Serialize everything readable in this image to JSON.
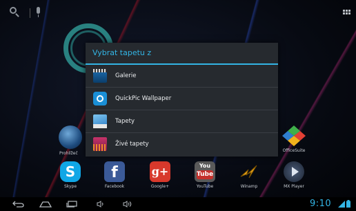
{
  "dialog": {
    "title": "Vybrat tapetu z",
    "items": [
      {
        "label": "Galerie",
        "icon": "gallery-icon"
      },
      {
        "label": "QuickPic Wallpaper",
        "icon": "quickpic-icon"
      },
      {
        "label": "Tapety",
        "icon": "wallpapers-icon"
      },
      {
        "label": "Živé tapety",
        "icon": "live-wallpapers-icon"
      }
    ]
  },
  "home": {
    "row_labels": [
      "Prohlížeč",
      "OfficeSuite"
    ],
    "dock": [
      {
        "label": "Skype",
        "icon": "skype-icon"
      },
      {
        "label": "Facebook",
        "icon": "facebook-icon"
      },
      {
        "label": "Google+",
        "icon": "googleplus-icon"
      },
      {
        "label": "YouTube",
        "icon": "youtube-icon"
      },
      {
        "label": "Winamp",
        "icon": "winamp-icon"
      },
      {
        "label": "MX Player",
        "icon": "mxplayer-icon"
      }
    ],
    "youtube_glyph": {
      "top": "You",
      "bottom": "Tube"
    },
    "facebook_glyph": "f",
    "googleplus_glyph": "g+"
  },
  "status": {
    "time": "9:10"
  },
  "colors": {
    "accent": "#33b5e5",
    "dialog_bg": "#262a2f"
  }
}
